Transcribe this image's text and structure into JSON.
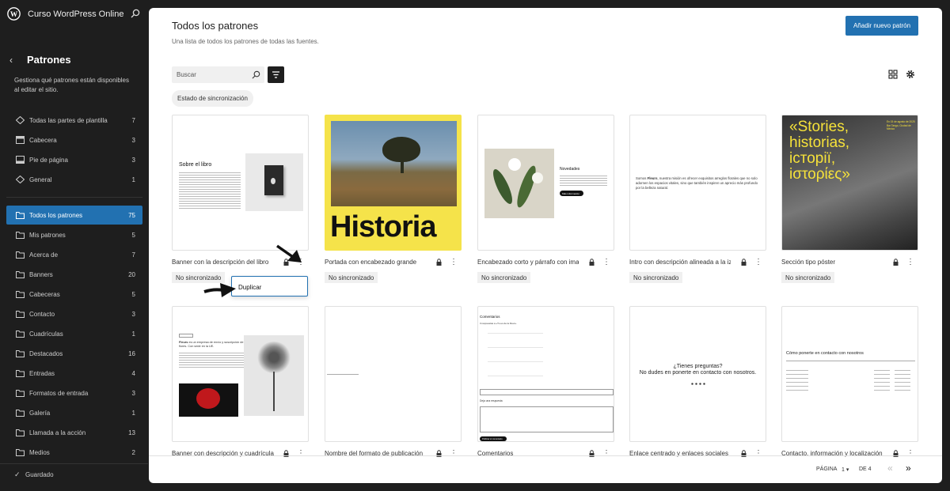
{
  "site": {
    "name": "Curso WordPress Online"
  },
  "sidebar": {
    "back_icon": "chevron-left",
    "title": "Patrones",
    "description": "Gestiona qué patrones están disponibles al editar el sitio.",
    "template_parts": [
      {
        "label": "Todas las partes de plantilla",
        "count": "7",
        "icon": "diamond"
      },
      {
        "label": "Cabecera",
        "count": "3",
        "icon": "header"
      },
      {
        "label": "Pie de página",
        "count": "3",
        "icon": "footer"
      },
      {
        "label": "General",
        "count": "1",
        "icon": "diamond"
      }
    ],
    "categories": [
      {
        "label": "Todos los patrones",
        "count": "75",
        "active": true
      },
      {
        "label": "Mis patrones",
        "count": "5"
      },
      {
        "label": "Acerca de",
        "count": "7"
      },
      {
        "label": "Banners",
        "count": "20"
      },
      {
        "label": "Cabeceras",
        "count": "5"
      },
      {
        "label": "Contacto",
        "count": "3"
      },
      {
        "label": "Cuadrículas",
        "count": "1"
      },
      {
        "label": "Destacados",
        "count": "16"
      },
      {
        "label": "Entradas",
        "count": "4"
      },
      {
        "label": "Formatos de entrada",
        "count": "3"
      },
      {
        "label": "Galería",
        "count": "1"
      },
      {
        "label": "Llamada a la acción",
        "count": "13"
      },
      {
        "label": "Medios",
        "count": "2"
      }
    ],
    "footer": {
      "check": "✓",
      "label": "Guardado"
    }
  },
  "header": {
    "title": "Todos los patrones",
    "subtitle": "Una lista de todos los patrones de todas las fuentes.",
    "add_button": "Añadir nuevo patrón"
  },
  "toolbar": {
    "search_placeholder": "Buscar",
    "filter_chip": "Estado de sincronización"
  },
  "cards": [
    {
      "title": "Banner con la descripción del libro",
      "status": "No sincronizado"
    },
    {
      "title": "Portada con encabezado grande",
      "status": "No sincronizado"
    },
    {
      "title": "Encabezado corto y párrafo con imagen",
      "status": "No sincronizado"
    },
    {
      "title": "Intro con descripción alineada a la izquierda",
      "status": "No sincronizado"
    },
    {
      "title": "Sección tipo póster",
      "status": "No sincronizado"
    },
    {
      "title": "Banner con descripción y cuadrícula",
      "status": ""
    },
    {
      "title": "Nombre del formato de publicación",
      "status": ""
    },
    {
      "title": "Comentarios",
      "status": ""
    },
    {
      "title": "Enlace centrado y enlaces sociales",
      "status": ""
    },
    {
      "title": "Contacto, información y localización",
      "status": ""
    }
  ],
  "previews": {
    "book": {
      "heading": "Sobre el libro"
    },
    "cover": {
      "big_text": "Historia"
    },
    "short": {
      "heading": "Novedades",
      "button": "Más información"
    },
    "intro": {
      "text_a": "Somos ",
      "bold": "Fleurs",
      "text_b": ", nuestra misión es ofrecer exquisitos arreglos florales que no solo adornen los espacios vitales, sino que también inspiren un aprecio más profundo por la belleza natural."
    },
    "poster": {
      "text": "«Stories, historias, історії, iστορίες»",
      "side": "En 15 de agosto de 2025 Bar Tango, Ciudad de México"
    },
    "grid": {
      "bold": "Fleurs",
      "text": " es un empresa de envío y suscripción de flores. Con sede en la UE."
    },
    "comments": {
      "heading": "Comentarios",
      "sub": "3 respuestas a «Tu es de la Fleur»",
      "reply": "Deja una respuesta",
      "button": "Publicar el comentario"
    },
    "social": {
      "line1": "¿Tienes preguntas?",
      "line2": "No dudes en ponerte en contacto con nosotros."
    },
    "contact": {
      "heading": "Cómo ponerte en contacto con nosotros"
    }
  },
  "popover": {
    "label": "Duplicar"
  },
  "pagination": {
    "label": "PÁGINA",
    "current": "1",
    "of": "DE 4",
    "prev": "«",
    "next": "»"
  },
  "colors": {
    "accent": "#2271b1",
    "sidebar_bg": "#1e1e1e",
    "poster_yellow": "#f6e23a",
    "cover_yellow": "#f5e34a"
  }
}
